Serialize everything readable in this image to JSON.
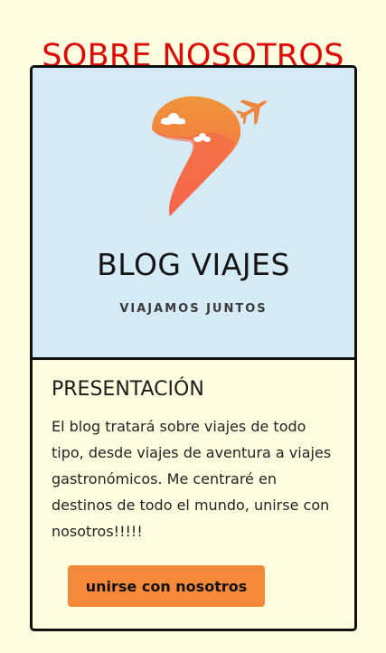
{
  "page": {
    "title": "SOBRE NOSOTROS"
  },
  "logo": {
    "brand_name": "BLOG VIAJES",
    "tagline": "VIAJAMOS JUNTOS",
    "icons": [
      "map-pin-icon",
      "airplane-icon",
      "cloud-icon"
    ],
    "colors": {
      "pin_top": "#f08d3c",
      "pin_bottom": "#f66a4a",
      "background": "#d4ebf6"
    }
  },
  "presentation": {
    "heading": "PRESENTACIÓN",
    "text": "El blog tratará sobre viajes de todo tipo, desde viajes de aventura a viajes gastronómicos. Me centraré en destinos de todo el mundo, unirse con nosotros!!!!!",
    "button_label": "unirse con nosotros"
  },
  "colors": {
    "page_background": "#fefde0",
    "title": "#dd0a08",
    "button": "#f7893a",
    "border": "#111111"
  }
}
